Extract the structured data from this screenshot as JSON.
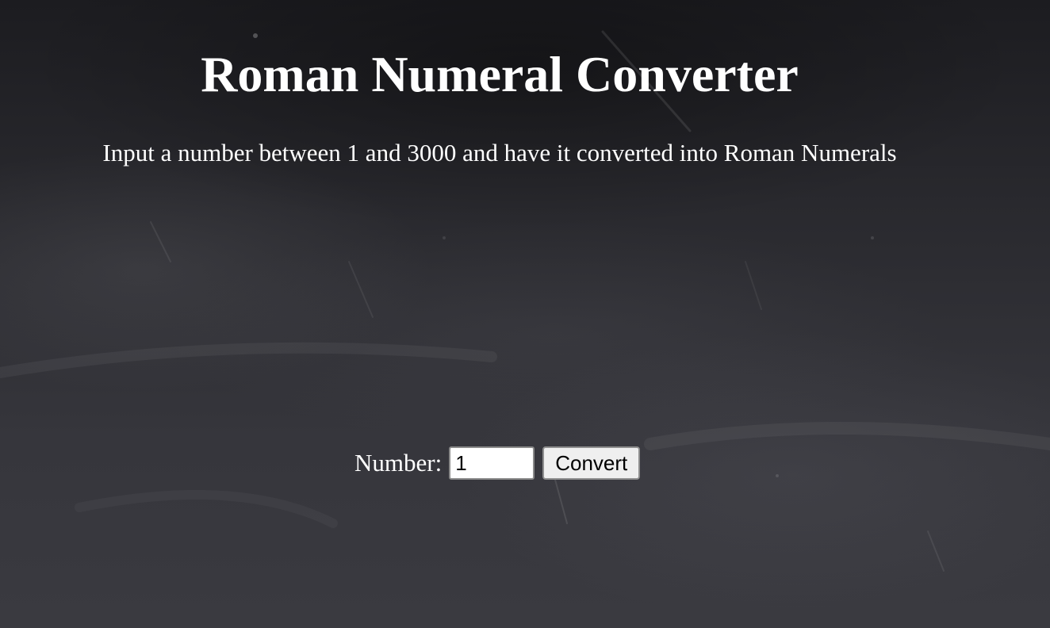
{
  "page": {
    "title": "Roman Numeral Converter",
    "subtitle": "Input a number between 1 and 3000 and have it converted into Roman Numerals"
  },
  "form": {
    "number_label": "Number:",
    "number_value": "1",
    "convert_label": "Convert"
  },
  "colors": {
    "background": "#2a2a2f",
    "text": "#ffffff",
    "button_bg": "#efefef"
  }
}
